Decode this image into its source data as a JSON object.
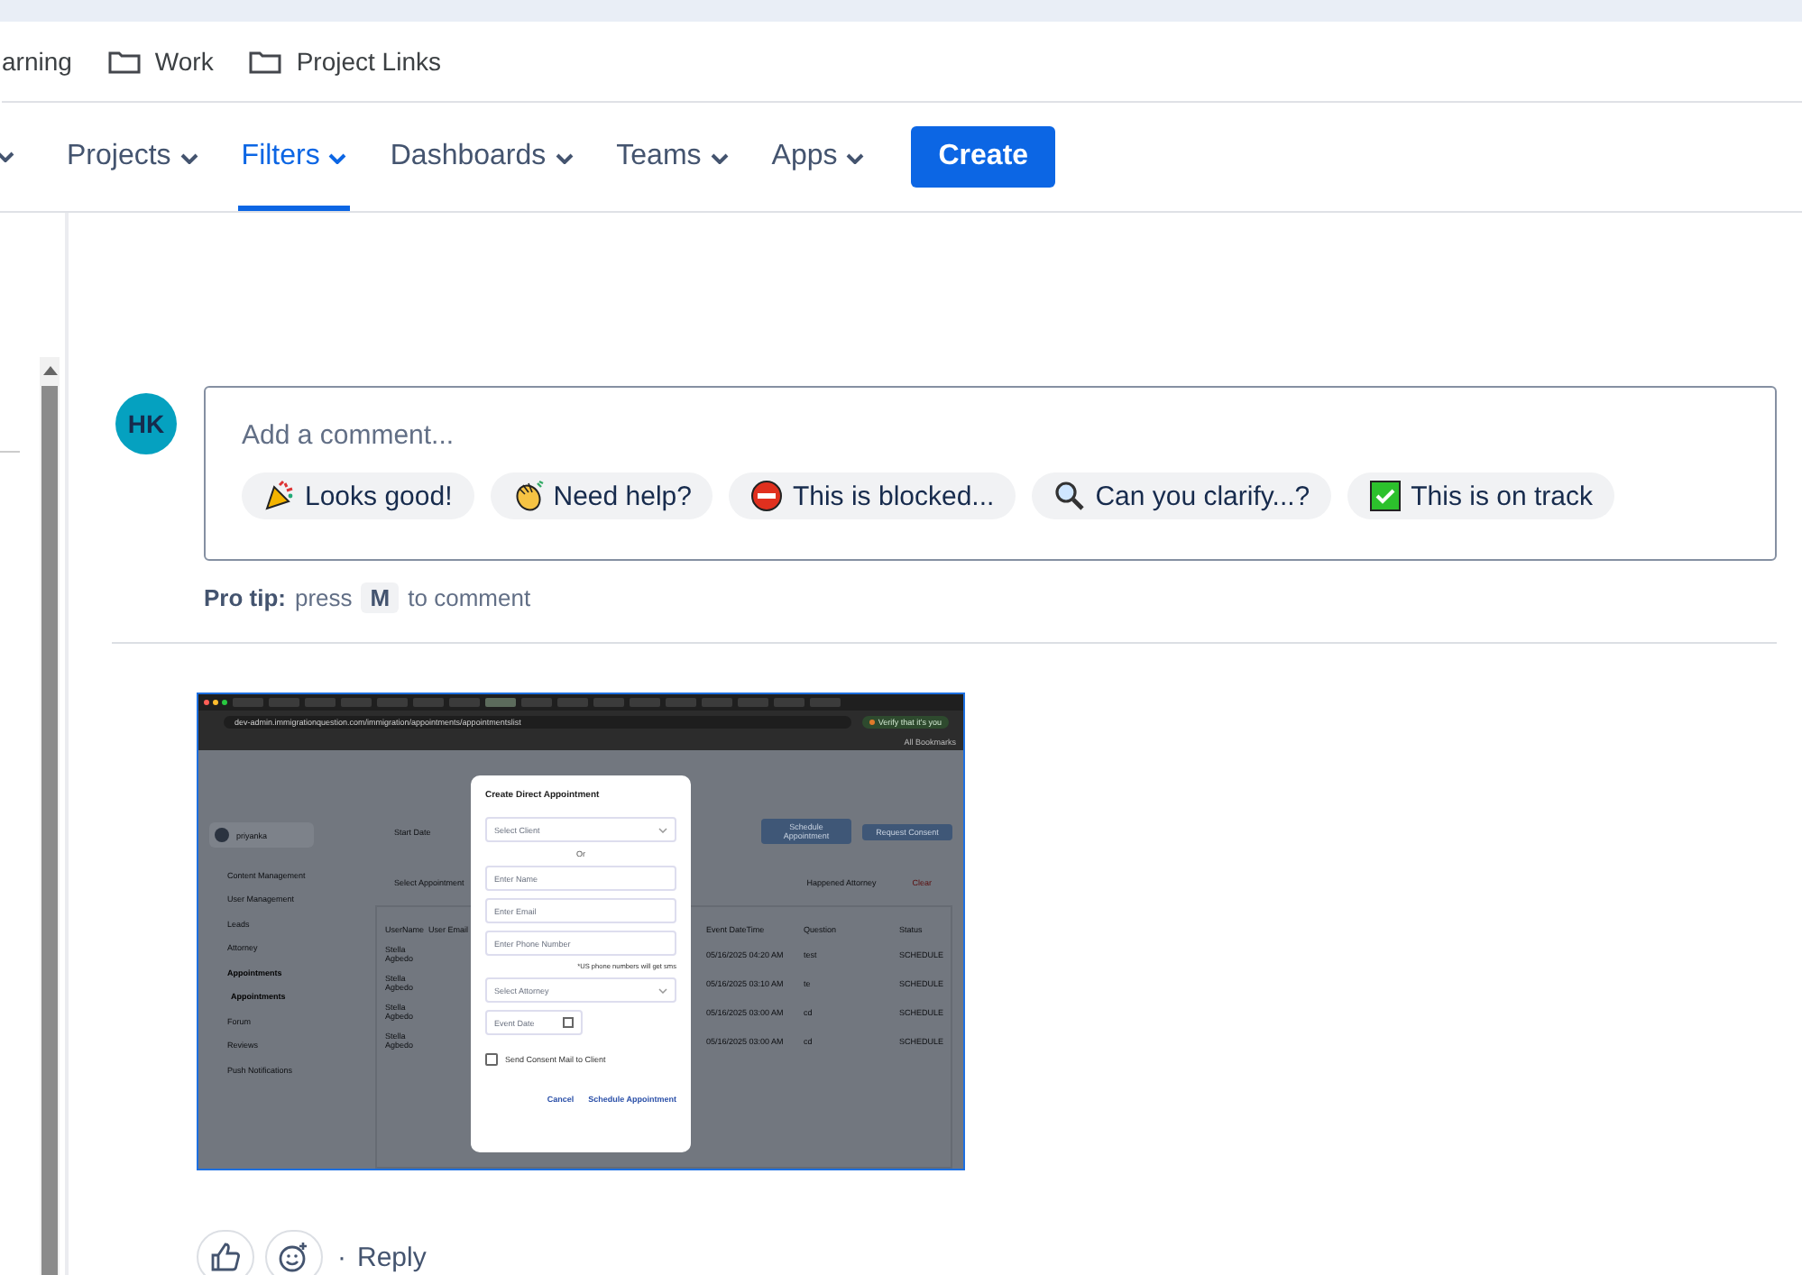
{
  "bookmarks": [
    {
      "label": "arning",
      "kind": "plain"
    },
    {
      "label": "Work",
      "kind": "folder"
    },
    {
      "label": "Project Links",
      "kind": "folder"
    }
  ],
  "nav": {
    "items": [
      {
        "label": "Projects",
        "selected": false
      },
      {
        "label": "Filters",
        "selected": true
      },
      {
        "label": "Dashboards",
        "selected": false
      },
      {
        "label": "Teams",
        "selected": false
      },
      {
        "label": "Apps",
        "selected": false
      }
    ],
    "create": "Create"
  },
  "comment": {
    "avatar": "HK",
    "placeholder": "Add a comment...",
    "quick_replies": [
      {
        "kind": "party",
        "label": "Looks good!"
      },
      {
        "kind": "wave",
        "label": "Need help?"
      },
      {
        "kind": "blocked",
        "label": "This is blocked..."
      },
      {
        "kind": "clarify",
        "label": "Can you clarify...?"
      },
      {
        "kind": "ontrack",
        "label": "This is on track"
      }
    ],
    "pro_tip": {
      "label": "Pro tip:",
      "before": "press",
      "key": "M",
      "after": "to comment"
    }
  },
  "attachment": {
    "url": "dev-admin.immigrationquestion.com/immigration/appointments/appointmentslist",
    "verify": "Verify that it's you",
    "all_bookmarks": "All Bookmarks",
    "user": "priyanka",
    "sidebar": [
      {
        "label": "Content Management",
        "selected": false
      },
      {
        "label": "User Management",
        "selected": false
      },
      {
        "label": "Leads",
        "selected": false
      },
      {
        "label": "Attorney",
        "selected": false
      },
      {
        "label": "Appointments",
        "selected": true,
        "children": [
          {
            "label": "Appointments",
            "selected": true
          }
        ]
      },
      {
        "label": "Forum",
        "selected": false
      },
      {
        "label": "Reviews",
        "selected": false
      },
      {
        "label": "Push Notifications",
        "selected": false
      }
    ],
    "start_date": "Start Date",
    "buttons": [
      "Schedule Appointment",
      "Request Consent"
    ],
    "filters": [
      "Select Appointment",
      "Happened Attorney"
    ],
    "clear": "Clear",
    "table": {
      "columns": [
        "UserName",
        "User Email",
        "Event DateTime",
        "Question",
        "Status"
      ],
      "rows": [
        {
          "user": "Stella Agbedo",
          "datetime": "05/16/2025 04:20 AM",
          "question": "test",
          "status": "SCHEDULE"
        },
        {
          "user": "Stella Agbedo",
          "datetime": "05/16/2025 03:10 AM",
          "question": "te",
          "status": "SCHEDULE"
        },
        {
          "user": "Stella Agbedo",
          "datetime": "05/16/2025 03:00 AM",
          "question": "cd",
          "status": "SCHEDULE"
        },
        {
          "user": "Stella Agbedo",
          "datetime": "05/16/2025 03:00 AM",
          "question": "cd",
          "status": "SCHEDULE"
        }
      ]
    },
    "dialog": {
      "title": "Create Direct Appointment",
      "fields": [
        {
          "kind": "select",
          "text": "Select Client"
        },
        {
          "kind": "separator",
          "text": "Or"
        },
        {
          "kind": "input",
          "text": "Enter Name"
        },
        {
          "kind": "input",
          "text": "Enter Email"
        },
        {
          "kind": "input",
          "text": "Enter Phone Number"
        },
        {
          "kind": "hint",
          "text": "*US phone numbers will get sms"
        },
        {
          "kind": "select",
          "text": "Select Attorney"
        },
        {
          "kind": "date",
          "text": "Event Date"
        }
      ],
      "checkbox": {
        "label": "Send Consent Mail to Client",
        "checked": false
      },
      "actions": [
        "Cancel",
        "Schedule Appointment"
      ]
    }
  },
  "footer": {
    "separator": "·",
    "reply": "Reply"
  }
}
